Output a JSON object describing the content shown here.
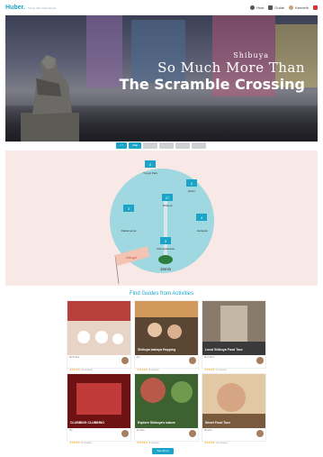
{
  "header": {
    "logo": "Huber.",
    "tagline": "Travel with local friends",
    "nav": [
      {
        "label": "Host",
        "icon": "help-icon"
      },
      {
        "label": "Guide",
        "icon": "book-icon"
      },
      {
        "label": "Kenneth",
        "icon": "avatar"
      },
      {
        "label": "",
        "icon": "japan-flag-icon"
      }
    ]
  },
  "hero": {
    "place": "Shibuya",
    "line1": "So Much More Than",
    "line2": "The Scramble Crossing"
  },
  "tabs": [
    "< >",
    "Map",
    "",
    "",
    "",
    ""
  ],
  "map": {
    "spots": [
      {
        "num": "2",
        "name": "Yoyogi Park"
      },
      {
        "num": "27",
        "name": "Shibuya"
      },
      {
        "num": "2",
        "name": "Ebisu"
      },
      {
        "num": "3",
        "name": "Daikanyama"
      },
      {
        "num": "4",
        "name": "Harajuku"
      },
      {
        "num": "3",
        "name": "Shimokitazawa"
      }
    ],
    "station": "Shibuya",
    "distance": "15min",
    "banner": "Lets go!"
  },
  "guides_section": {
    "title": "Find Guides from Activities",
    "see_more": "See More"
  },
  "cards": [
    {
      "label": "",
      "meta": "3H 5.1km",
      "stars": "★★★★★",
      "count": "(12 reviews)",
      "color1": "#b8403c",
      "color2": "#e8d4c6"
    },
    {
      "label": "Shibuya Izakaya Hopping",
      "meta": "3H",
      "stars": "★★★★★",
      "count": "(9 reviews)",
      "color1": "#5a4632",
      "color2": "#d19a5c"
    },
    {
      "label": "Local Shibuya Food Tour",
      "meta": "3H 4.5km",
      "stars": "★★★★★",
      "count": "(7 reviews)",
      "color1": "#8a7a6c",
      "color2": "#c4b7a6"
    },
    {
      "label": "CLUBBING CLUBBING",
      "meta": "4H",
      "stars": "★★★★★",
      "count": "(5 reviews)",
      "color1": "#6e1214",
      "color2": "#c13a3a"
    },
    {
      "label": "Explore Shibuya's nature",
      "meta": "2H 3km",
      "stars": "★★★★★",
      "count": "(6 reviews)",
      "color1": "#3e6132",
      "color2": "#b85a4a"
    },
    {
      "label": "Street Food Tour",
      "meta": "3H 2km",
      "stars": "★★★★★",
      "count": "(11 reviews)",
      "color1": "#e3c8a6",
      "color2": "#7a5a3c"
    }
  ]
}
